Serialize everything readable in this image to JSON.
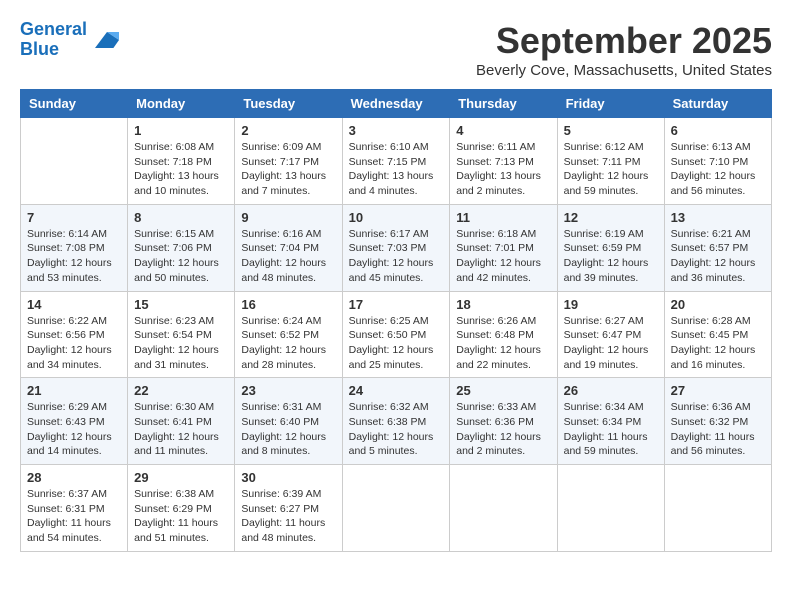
{
  "logo": {
    "line1": "General",
    "line2": "Blue"
  },
  "title": "September 2025",
  "location": "Beverly Cove, Massachusetts, United States",
  "days_of_week": [
    "Sunday",
    "Monday",
    "Tuesday",
    "Wednesday",
    "Thursday",
    "Friday",
    "Saturday"
  ],
  "weeks": [
    [
      {
        "day": "",
        "text": ""
      },
      {
        "day": "1",
        "text": "Sunrise: 6:08 AM\nSunset: 7:18 PM\nDaylight: 13 hours\nand 10 minutes."
      },
      {
        "day": "2",
        "text": "Sunrise: 6:09 AM\nSunset: 7:17 PM\nDaylight: 13 hours\nand 7 minutes."
      },
      {
        "day": "3",
        "text": "Sunrise: 6:10 AM\nSunset: 7:15 PM\nDaylight: 13 hours\nand 4 minutes."
      },
      {
        "day": "4",
        "text": "Sunrise: 6:11 AM\nSunset: 7:13 PM\nDaylight: 13 hours\nand 2 minutes."
      },
      {
        "day": "5",
        "text": "Sunrise: 6:12 AM\nSunset: 7:11 PM\nDaylight: 12 hours\nand 59 minutes."
      },
      {
        "day": "6",
        "text": "Sunrise: 6:13 AM\nSunset: 7:10 PM\nDaylight: 12 hours\nand 56 minutes."
      }
    ],
    [
      {
        "day": "7",
        "text": "Sunrise: 6:14 AM\nSunset: 7:08 PM\nDaylight: 12 hours\nand 53 minutes."
      },
      {
        "day": "8",
        "text": "Sunrise: 6:15 AM\nSunset: 7:06 PM\nDaylight: 12 hours\nand 50 minutes."
      },
      {
        "day": "9",
        "text": "Sunrise: 6:16 AM\nSunset: 7:04 PM\nDaylight: 12 hours\nand 48 minutes."
      },
      {
        "day": "10",
        "text": "Sunrise: 6:17 AM\nSunset: 7:03 PM\nDaylight: 12 hours\nand 45 minutes."
      },
      {
        "day": "11",
        "text": "Sunrise: 6:18 AM\nSunset: 7:01 PM\nDaylight: 12 hours\nand 42 minutes."
      },
      {
        "day": "12",
        "text": "Sunrise: 6:19 AM\nSunset: 6:59 PM\nDaylight: 12 hours\nand 39 minutes."
      },
      {
        "day": "13",
        "text": "Sunrise: 6:21 AM\nSunset: 6:57 PM\nDaylight: 12 hours\nand 36 minutes."
      }
    ],
    [
      {
        "day": "14",
        "text": "Sunrise: 6:22 AM\nSunset: 6:56 PM\nDaylight: 12 hours\nand 34 minutes."
      },
      {
        "day": "15",
        "text": "Sunrise: 6:23 AM\nSunset: 6:54 PM\nDaylight: 12 hours\nand 31 minutes."
      },
      {
        "day": "16",
        "text": "Sunrise: 6:24 AM\nSunset: 6:52 PM\nDaylight: 12 hours\nand 28 minutes."
      },
      {
        "day": "17",
        "text": "Sunrise: 6:25 AM\nSunset: 6:50 PM\nDaylight: 12 hours\nand 25 minutes."
      },
      {
        "day": "18",
        "text": "Sunrise: 6:26 AM\nSunset: 6:48 PM\nDaylight: 12 hours\nand 22 minutes."
      },
      {
        "day": "19",
        "text": "Sunrise: 6:27 AM\nSunset: 6:47 PM\nDaylight: 12 hours\nand 19 minutes."
      },
      {
        "day": "20",
        "text": "Sunrise: 6:28 AM\nSunset: 6:45 PM\nDaylight: 12 hours\nand 16 minutes."
      }
    ],
    [
      {
        "day": "21",
        "text": "Sunrise: 6:29 AM\nSunset: 6:43 PM\nDaylight: 12 hours\nand 14 minutes."
      },
      {
        "day": "22",
        "text": "Sunrise: 6:30 AM\nSunset: 6:41 PM\nDaylight: 12 hours\nand 11 minutes."
      },
      {
        "day": "23",
        "text": "Sunrise: 6:31 AM\nSunset: 6:40 PM\nDaylight: 12 hours\nand 8 minutes."
      },
      {
        "day": "24",
        "text": "Sunrise: 6:32 AM\nSunset: 6:38 PM\nDaylight: 12 hours\nand 5 minutes."
      },
      {
        "day": "25",
        "text": "Sunrise: 6:33 AM\nSunset: 6:36 PM\nDaylight: 12 hours\nand 2 minutes."
      },
      {
        "day": "26",
        "text": "Sunrise: 6:34 AM\nSunset: 6:34 PM\nDaylight: 11 hours\nand 59 minutes."
      },
      {
        "day": "27",
        "text": "Sunrise: 6:36 AM\nSunset: 6:32 PM\nDaylight: 11 hours\nand 56 minutes."
      }
    ],
    [
      {
        "day": "28",
        "text": "Sunrise: 6:37 AM\nSunset: 6:31 PM\nDaylight: 11 hours\nand 54 minutes."
      },
      {
        "day": "29",
        "text": "Sunrise: 6:38 AM\nSunset: 6:29 PM\nDaylight: 11 hours\nand 51 minutes."
      },
      {
        "day": "30",
        "text": "Sunrise: 6:39 AM\nSunset: 6:27 PM\nDaylight: 11 hours\nand 48 minutes."
      },
      {
        "day": "",
        "text": ""
      },
      {
        "day": "",
        "text": ""
      },
      {
        "day": "",
        "text": ""
      },
      {
        "day": "",
        "text": ""
      }
    ]
  ]
}
